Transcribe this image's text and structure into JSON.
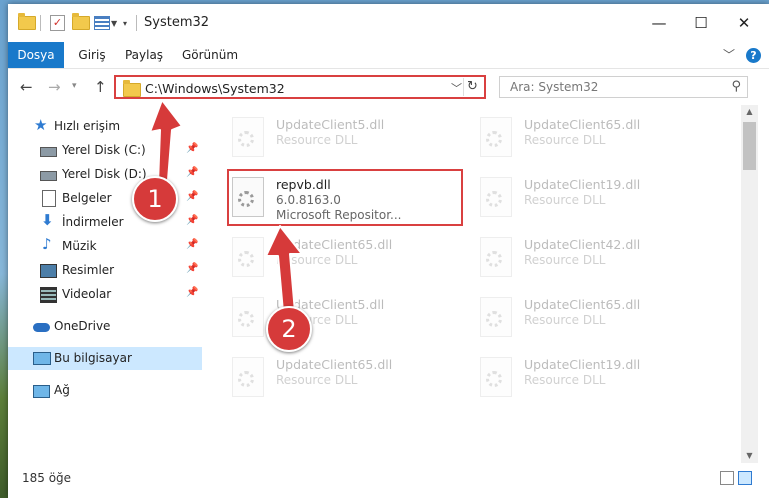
{
  "window": {
    "title": "System32"
  },
  "quick_access_icons": [
    "folder-icon",
    "properties-check-icon",
    "new-folder-icon",
    "customize-icon"
  ],
  "ribbon": {
    "tabs": [
      "Dosya",
      "Giriş",
      "Paylaş",
      "Görünüm"
    ],
    "help": "?"
  },
  "nav": {
    "back": "←",
    "forward": "→",
    "up": "↑",
    "address": "C:\\Windows\\System32",
    "search_placeholder": "Ara: System32"
  },
  "sidebar": {
    "items": [
      {
        "label": "Hızlı erişim",
        "icon": "star-icon",
        "pinned": false
      },
      {
        "label": "Yerel Disk (C:)",
        "icon": "drive-icon",
        "pinned": true
      },
      {
        "label": "Yerel Disk (D:)",
        "icon": "drive-icon",
        "pinned": true
      },
      {
        "label": "Belgeler",
        "icon": "documents-icon",
        "pinned": true
      },
      {
        "label": "İndirmeler",
        "icon": "download-icon",
        "pinned": true
      },
      {
        "label": "Müzik",
        "icon": "music-icon",
        "pinned": true
      },
      {
        "label": "Resimler",
        "icon": "pictures-icon",
        "pinned": true
      },
      {
        "label": "Videolar",
        "icon": "videos-icon",
        "pinned": true
      },
      {
        "label": "OneDrive",
        "icon": "onedrive-icon",
        "pinned": false
      },
      {
        "label": "Bu bilgisayar",
        "icon": "computer-icon",
        "pinned": false,
        "selected": true
      },
      {
        "label": "Ağ",
        "icon": "network-icon",
        "pinned": false
      }
    ]
  },
  "files": [
    {
      "name": "UpdateClient5.dll",
      "type": "Resource DLL",
      "faded": true
    },
    {
      "name": "UpdateClient65.dll",
      "type": "Resource DLL",
      "faded": true
    },
    {
      "name": "repvb.dll",
      "version": "6.0.8163.0",
      "type": "Microsoft Repositor...",
      "faded": false,
      "highlighted": true
    },
    {
      "name": "UpdateClient19.dll",
      "type": "Resource DLL",
      "faded": true
    },
    {
      "name": "UpdateClient65.dll",
      "type": "Resource DLL",
      "faded": true
    },
    {
      "name": "UpdateClient42.dll",
      "type": "Resource DLL",
      "faded": true
    },
    {
      "name": "UpdateClient5.dll",
      "type": "Resource DLL",
      "faded": true
    },
    {
      "name": "UpdateClient65.dll",
      "type": "Resource DLL",
      "faded": true
    },
    {
      "name": "UpdateClient65.dll",
      "type": "Resource DLL",
      "faded": true
    },
    {
      "name": "UpdateClient19.dll",
      "type": "Resource DLL",
      "faded": true
    }
  ],
  "status": {
    "count": "185 öğe"
  },
  "annotations": {
    "step1": "1",
    "step2": "2",
    "color": "#d63a3a"
  }
}
